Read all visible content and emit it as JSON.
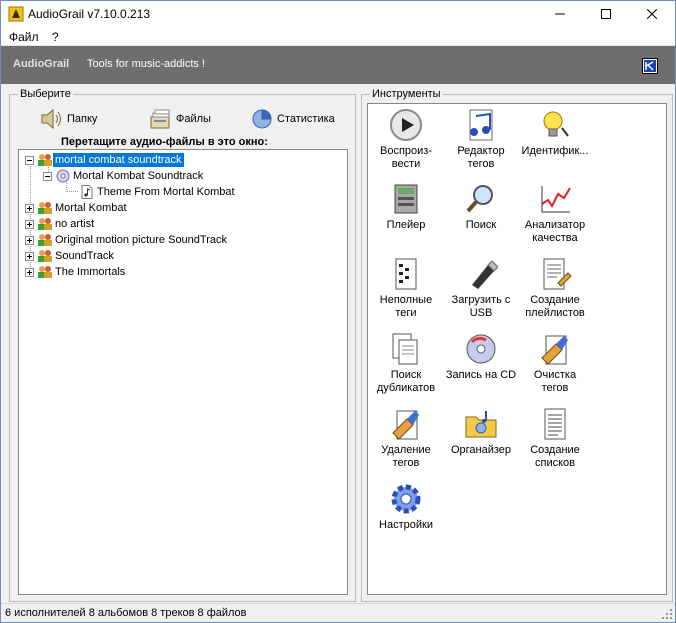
{
  "window": {
    "title": "AudioGrail v7.10.0.213"
  },
  "menu": {
    "items": [
      "Файл",
      "?"
    ]
  },
  "banner": {
    "brand": "AudioGrail",
    "tagline": "Tools for music-addicts !"
  },
  "left_panel": {
    "label": "Выберите",
    "buttons": {
      "folder": "Папку",
      "files": "Файлы",
      "stats": "Статистика"
    },
    "drop_title": "Перетащите аудио-файлы в это окно:"
  },
  "tree": {
    "items": [
      {
        "label": "mortal combat soundtrack",
        "level": 0,
        "expanded": true,
        "selected": true,
        "icon": "artists-icon"
      },
      {
        "label": "Mortal Kombat Soundtrack",
        "level": 1,
        "expanded": true,
        "icon": "cd-album-icon"
      },
      {
        "label": "Theme From Mortal Kombat",
        "level": 2,
        "icon": "music-file-icon"
      },
      {
        "label": "Mortal Kombat",
        "level": 0,
        "expanded": false,
        "icon": "artists-icon"
      },
      {
        "label": "no artist",
        "level": 0,
        "expanded": false,
        "icon": "artists-icon"
      },
      {
        "label": "Original motion picture SoundTrack",
        "level": 0,
        "expanded": false,
        "icon": "artists-icon"
      },
      {
        "label": "SoundTrack",
        "level": 0,
        "expanded": false,
        "icon": "artists-icon"
      },
      {
        "label": "The Immortals",
        "level": 0,
        "expanded": false,
        "icon": "artists-icon"
      }
    ]
  },
  "tools": {
    "label": "Инструменты",
    "items": [
      {
        "line1": "Воспроиз-",
        "line2": "вести",
        "icon": "play-icon"
      },
      {
        "line1": "Редактор",
        "line2": "тегов",
        "icon": "tag-editor-icon"
      },
      {
        "line1": "Идентифик...",
        "line2": "",
        "icon": "lightbulb-icon"
      },
      {
        "line1": "Плейер",
        "line2": "",
        "icon": "player-icon"
      },
      {
        "line1": "Поиск",
        "line2": "",
        "icon": "magnifier-icon"
      },
      {
        "line1": "Анализатор",
        "line2": "качества",
        "icon": "chart-icon"
      },
      {
        "line1": "Неполные",
        "line2": "теги",
        "icon": "incomplete-tags-icon"
      },
      {
        "line1": "Загрузить с",
        "line2": "USB",
        "icon": "usb-icon"
      },
      {
        "line1": "Создание",
        "line2": "плейлистов",
        "icon": "playlist-icon"
      },
      {
        "line1": "Поиск",
        "line2": "дубликатов",
        "icon": "duplicates-icon"
      },
      {
        "line1": "Запись на CD",
        "line2": "",
        "icon": "burn-cd-icon"
      },
      {
        "line1": "Очистка",
        "line2": "тегов",
        "icon": "clean-tags-icon"
      },
      {
        "line1": "Удаление",
        "line2": "тегов",
        "icon": "delete-tags-icon"
      },
      {
        "line1": "Органайзер",
        "line2": "",
        "icon": "organizer-icon"
      },
      {
        "line1": "Создание",
        "line2": "списков",
        "icon": "lists-icon"
      },
      {
        "line1": "Настройки",
        "line2": "",
        "icon": "settings-gear-icon"
      }
    ]
  },
  "status": {
    "text": "6 исполнителей 8 альбомов 8 треков 8 файлов"
  },
  "colors": {
    "selection": "#0078d7",
    "banner": "#6e6e6e"
  }
}
